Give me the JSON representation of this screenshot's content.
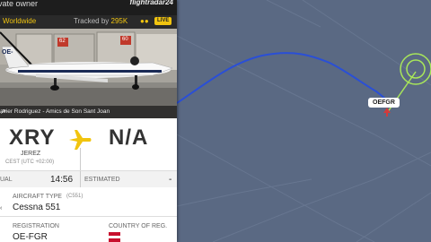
{
  "header": {
    "owner": "vate owner",
    "app_logo": "flightradar24",
    "region": "Worldwide",
    "tracked_prefix": "Tracked by",
    "tracked_count": "295K",
    "live_badge": "LIVE"
  },
  "photo": {
    "credit": "avier Rodriguez - Amics de Son Sant Joan",
    "tail_left": "OE-",
    "hangar_sign_1": "62",
    "hangar_sign_2": "60"
  },
  "route": {
    "origin_code": "XRY",
    "origin_city": "JEREZ",
    "origin_tz": "CEST (UTC +02:00)",
    "dest_code": "N/A"
  },
  "times": {
    "actual_label": "UAL",
    "actual_value": "14:56",
    "estimated_label": "ESTIMATED",
    "estimated_value": "-"
  },
  "aircraft": {
    "type_label": "AIRCRAFT TYPE",
    "type_code": "(C551)",
    "type_value": "Cessna 551",
    "registration_label": "REGISTRATION",
    "registration_value": "OE-FGR",
    "country_label": "COUNTRY OF REG."
  },
  "map": {
    "callsign": "OEFGR",
    "colors": {
      "track": "#2a4fd6",
      "water": "#5a6983",
      "highlight": "#a8e65a"
    }
  },
  "icons": [
    "people-icon",
    "external-link-icon",
    "plane-icon",
    "chevron-left-icon",
    "flag-icon"
  ]
}
